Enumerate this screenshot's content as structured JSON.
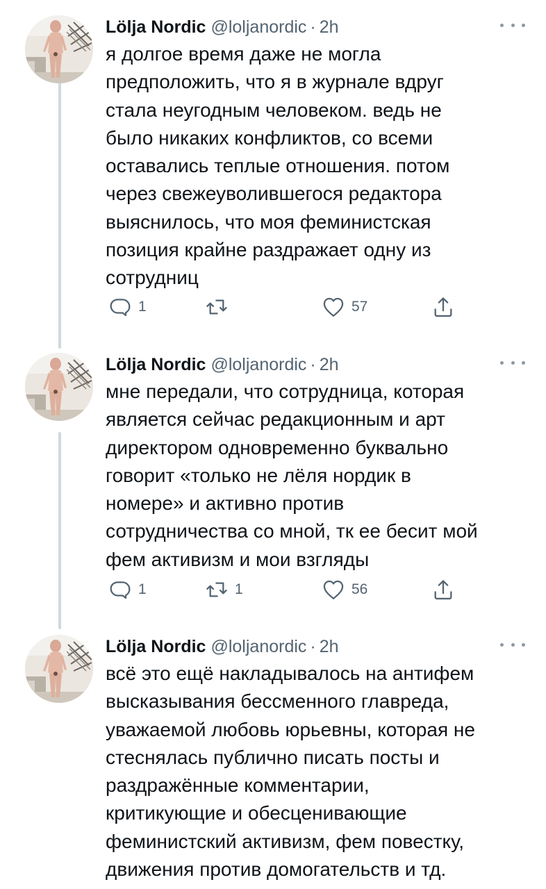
{
  "tweets": [
    {
      "name": "Lölja Nordic",
      "handle": "@loljanordic",
      "dot": "·",
      "time": "2h",
      "lines": [
        "я долгое время даже не могла",
        "предположить, что я в журнале вдруг",
        "стала неугодным человеком. ведь не",
        "было никаких конфликтов, со всеми",
        "оставались теплые отношения. потом",
        "через свежеуволившегося редактора",
        "выяснилось, что моя феминистская",
        "позиция крайне раздражает одну из",
        "сотрудниц"
      ],
      "replies": "1",
      "retweets": "",
      "likes": "57"
    },
    {
      "name": "Lölja Nordic",
      "handle": "@loljanordic",
      "dot": "·",
      "time": "2h",
      "lines": [
        "мне передали, что сотрудница, которая",
        "является сейчас редакционным и арт",
        "директором одновременно буквально",
        "говорит «только не лёля нордик в",
        "номере» и  активно против",
        "сотрудничества со мной, тк ее бесит мой",
        "фем активизм и мои взгляды"
      ],
      "replies": "1",
      "retweets": "1",
      "likes": "56"
    },
    {
      "name": "Lölja Nordic",
      "handle": "@loljanordic",
      "dot": "·",
      "time": "2h",
      "lines": [
        "всё это ещё накладывалось на антифем",
        "высказывания бессменного главреда,",
        "уважаемой любовь юрьевны, которая не",
        "стеснялась публично писать посты и",
        "раздражённые комментарии,",
        "критикующие и обесценивающие",
        "феминистский активизм, фем повестку,",
        "движения против домогательств и тд."
      ]
    }
  ],
  "icons": {
    "reply": "reply-icon",
    "retweet": "retweet-icon",
    "like": "like-icon",
    "share": "share-icon",
    "more": "more-icon"
  },
  "colors": {
    "text": "#0f1419",
    "secondary": "#536471",
    "thread_line": "#cfd9de"
  }
}
